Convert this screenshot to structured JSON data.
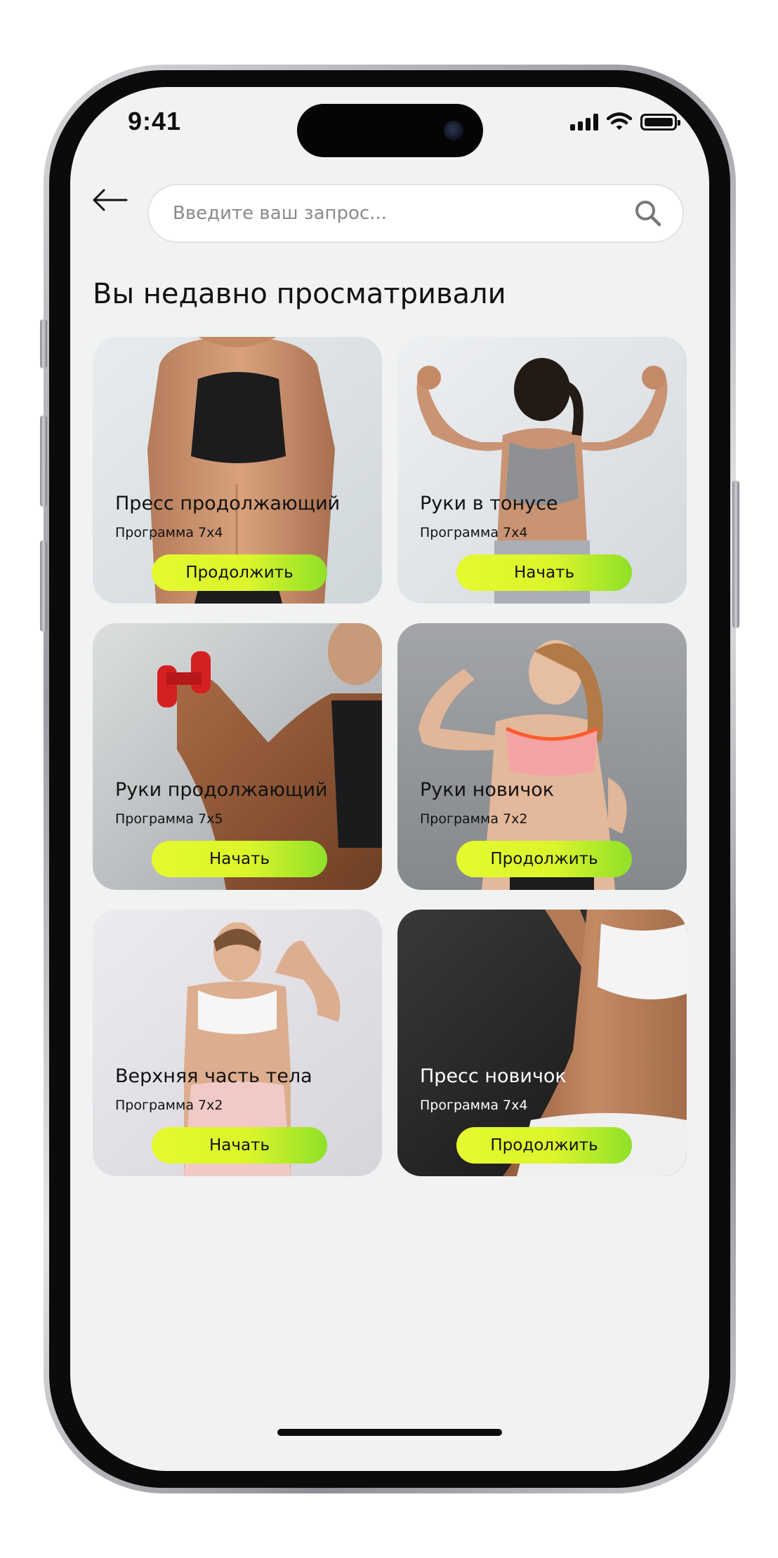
{
  "status_bar": {
    "time": "9:41"
  },
  "search": {
    "placeholder": "Введите ваш запрос..."
  },
  "section": {
    "title": "Вы недавно просматривали"
  },
  "cards": [
    {
      "title": "Пресс продолжающий",
      "subtitle": "Программа 7x4",
      "button": "Продолжить"
    },
    {
      "title": "Руки в тонусе",
      "subtitle": "Программа 7x4",
      "button": "Начать"
    },
    {
      "title": "Руки продолжающий",
      "subtitle": "Программа 7x5",
      "button": "Начать"
    },
    {
      "title": "Руки новичок",
      "subtitle": "Программа 7x2",
      "button": "Продолжить"
    },
    {
      "title": "Верхняя часть тела",
      "subtitle": "Программа 7x2",
      "button": "Начать"
    },
    {
      "title": "Пресс новичок",
      "subtitle": "Программа 7x4",
      "button": "Продолжить"
    }
  ],
  "colors": {
    "screen_bg": "#f1f3f2",
    "button_gradient_start": "#e5f92f",
    "button_gradient_end": "#8fe02a",
    "text": "#111111"
  }
}
